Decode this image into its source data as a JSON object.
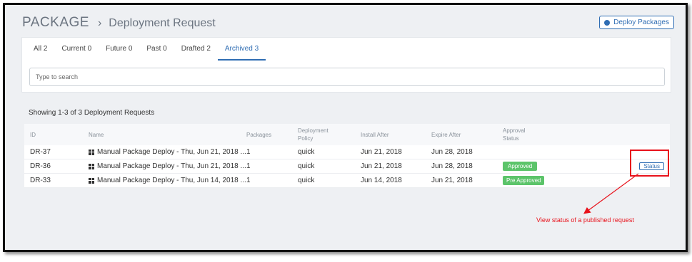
{
  "breadcrumb": {
    "root": "PACKAGE",
    "separator": "›",
    "page": "Deployment Request"
  },
  "toolbar": {
    "deploy_label": "Deploy Packages"
  },
  "tabs": [
    {
      "label": "All 2"
    },
    {
      "label": "Current 0"
    },
    {
      "label": "Future 0"
    },
    {
      "label": "Past 0"
    },
    {
      "label": "Drafted 2"
    },
    {
      "label": "Archived 3",
      "active": true
    }
  ],
  "search": {
    "placeholder": "Type to search",
    "value": ""
  },
  "summary": "Showing 1-3 of 3 Deployment Requests",
  "table": {
    "headers": {
      "id": "ID",
      "name": "Name",
      "packages": "Packages",
      "policy_1": "Deployment",
      "policy_2": "Policy",
      "install": "Install After",
      "expire": "Expire After",
      "approval_1": "Approval",
      "approval_2": "Status"
    },
    "rows": [
      {
        "id": "DR-37",
        "name": "Manual Package Deploy - Thu, Jun 21, 2018 ...",
        "packages": "1",
        "policy": "quick",
        "install": "Jun 21, 2018",
        "expire": "Jun 28, 2018",
        "approval": ""
      },
      {
        "id": "DR-36",
        "name": "Manual Package Deploy - Thu, Jun 21, 2018 ...",
        "packages": "1",
        "policy": "quick",
        "install": "Jun 21, 2018",
        "expire": "Jun 28, 2018",
        "approval": "Approved",
        "action": "Status"
      },
      {
        "id": "DR-33",
        "name": "Manual Package Deploy - Thu, Jun 14, 2018 ...",
        "packages": "1",
        "policy": "quick",
        "install": "Jun 14, 2018",
        "expire": "Jun 21, 2018",
        "approval": "Pre Approved"
      }
    ]
  },
  "annotation": {
    "text": "View status of a published request",
    "color": "#e8121b"
  },
  "colors": {
    "accent": "#2f6db3",
    "approved": "#5cc46a",
    "background": "#eef0f3"
  },
  "icons": {
    "deploy": "cube-icon",
    "row": "windows-icon"
  }
}
